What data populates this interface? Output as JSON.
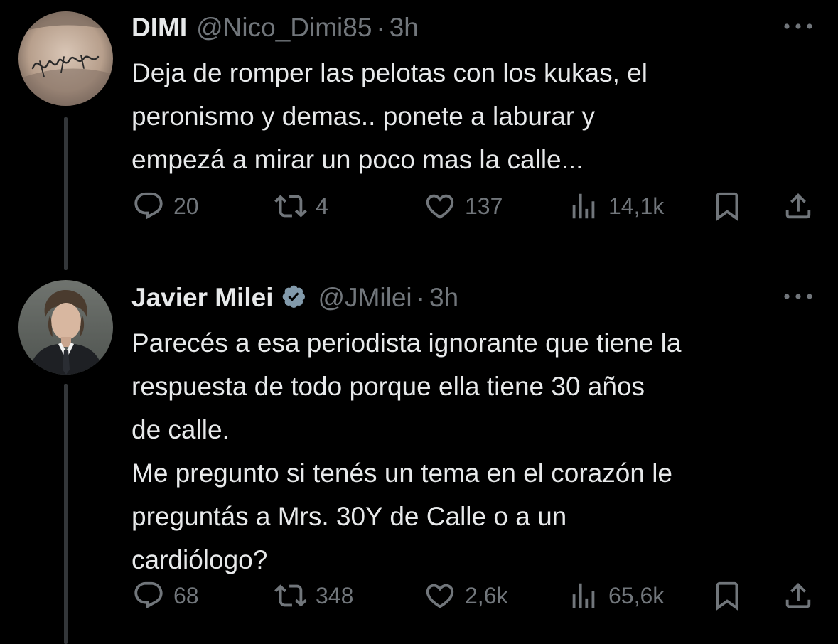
{
  "tweets": [
    {
      "name": "DIMI",
      "handle": "@Nico_Dimi85",
      "separator": "·",
      "time": "3h",
      "verified": false,
      "avatar": "tattoo-signature-avatar",
      "text_lines": [
        "Deja de romper las pelotas con los kukas, el",
        "peronismo y demas.. ponete a laburar y",
        "empezá a mirar un poco mas la calle..."
      ],
      "stats": {
        "replies": "20",
        "retweets": "4",
        "likes": "137",
        "views": "14,1k"
      }
    },
    {
      "name": "Javier Milei",
      "handle": "@JMilei",
      "separator": "·",
      "time": "3h",
      "verified": true,
      "avatar": "man-in-suit-avatar",
      "text_lines": [
        "Parecés a esa periodista ignorante que tiene la",
        "respuesta de todo porque ella tiene 30 años",
        "de calle.",
        "Me pregunto si tenés un tema en el corazón le",
        "preguntás a Mrs. 30Y de Calle o a un",
        "cardiólogo?"
      ],
      "stats": {
        "replies": "68",
        "retweets": "348",
        "likes": "2,6k",
        "views": "65,6k"
      }
    }
  ],
  "colors": {
    "background": "#000000",
    "text": "#e7e9ea",
    "muted": "#71767b",
    "thread_line": "#333639",
    "verified_badge": "#829aab"
  },
  "icons": [
    "reply-icon",
    "retweet-icon",
    "like-icon",
    "views-icon",
    "bookmark-icon",
    "share-icon",
    "more-icon",
    "verified-badge-icon"
  ]
}
